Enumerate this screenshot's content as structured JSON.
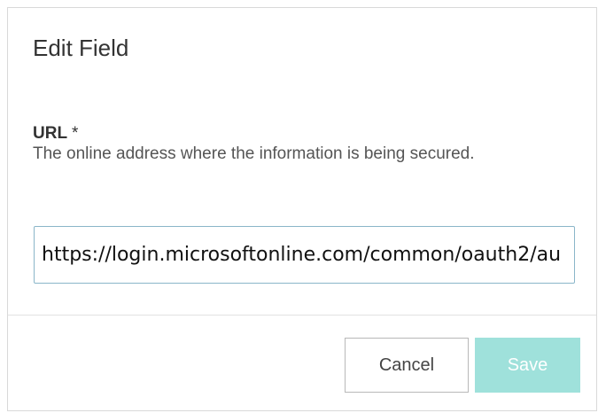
{
  "dialog": {
    "title": "Edit Field"
  },
  "field": {
    "label": "URL",
    "required_marker": "*",
    "help": "The online address where the information is being secured.",
    "value": "https://login.microsoftonline.com/common/oauth2/au"
  },
  "buttons": {
    "cancel_label": "Cancel",
    "save_label": "Save",
    "save_enabled": false
  },
  "colors": {
    "input_border": "#8ab6c9",
    "save_disabled_bg": "#9fe1db",
    "cancel_border": "#b8b8b8"
  }
}
